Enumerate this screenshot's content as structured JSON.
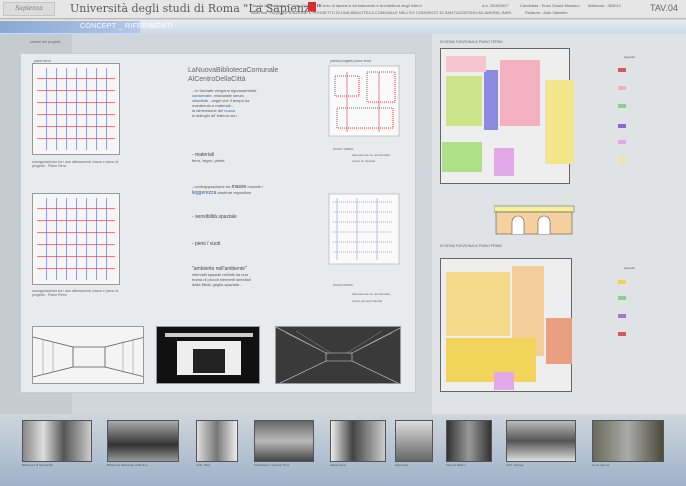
{
  "header": {
    "logo_text": "Sapienza",
    "university": "Università degli studi di Roma \"La Sapienza\"",
    "faculty": "Facoltà di Architettura \"Valle Giulia\"",
    "course": "Corso di laurea in Arredamento e Architettura degli interni",
    "thesis": "Titolo tesi : RIQUALIFICAZIONE E PROGETTO DI UNA BIBLIOTECA COMUNALE NELL'EX CONVENTO DI SANT'AGOSTINO AD ANDRIA, BARI",
    "year": "a.a. 2006/2007",
    "candidate": "Candidata : Enza Grazia Mosaico",
    "matricola": "Matricola : 363012",
    "relatore": "Relatore : Aldo Valentini",
    "tav": "TAV.04"
  },
  "band": {
    "title": "CONCEPT _ RIFERIMENTI"
  },
  "panel": {
    "label": "schemi del progetto",
    "plan1_label": "piano terra",
    "plan1_caption": "sovrapposizione tra i due allineamenti, tracce e piano di progetto - Piano Terra",
    "plan2_caption": "sovrapposizione tra i due allineamenti, tracce e piano di progetto - Piano Primo",
    "title_line1": "LaNuovaBibliotecaComunale",
    "title_line2": "AlCentroDellaCittà",
    "p1a": "...le facciate vengono rigorosamente",
    "p1b": "conservate",
    "p1c": ", restaurate senza",
    "p1d": "chiuderle ; segni che il tempo ha",
    "p1e": "mantenuto e materiali...",
    "p1f": "la dimensione del",
    "p1g": "nuovo",
    "p1h": "si dialoghi all' interno con :",
    "materials_h": "- materiali",
    "materials": "ferro, legno, pietra",
    "contrast_a": "- contrapposizione tra",
    "contrast_b": "masse",
    "contrast_c": "murarie /",
    "contrast_d": "leggerezza",
    "contrast_e": "strutture espositive",
    "sens": "- sensibilità spaziale",
    "pieni": "- pieni / vuoti",
    "amb_a": "\"ambiente nell'ambiente\"",
    "amb_b": "intervalli spaziali nell'atti da una",
    "amb_c": "trama di piccoli elementi lamellari",
    "amb_d": "della filitali, griglia spaziale...",
    "small_plans_label": "pianta progetto piano terra",
    "leg1": "allineamento su una facciata",
    "leg2": "tracce su facciata",
    "leg3": "allineamento su una facciata",
    "leg4": "tracce elementi laterali",
    "pt": "PIANO TERRA",
    "pp": "PIANO PRIMO"
  },
  "right": {
    "title1": "SCHEMA FUNZIONALE PIANO TERRA",
    "title2": "SCHEMA FUNZIONALE PIANO PRIMO",
    "legend_h": "legenda"
  },
  "photos": [
    {
      "caption": "Biblioteca di Stoccarda"
    },
    {
      "caption": "Biblioteca Nazionale di Berlino"
    },
    {
      "caption": "Arch. Mies"
    },
    {
      "caption": "Fondazione \"Herzog\" Pisa"
    },
    {
      "caption": "Allestimento"
    },
    {
      "caption": "Espositori"
    },
    {
      "caption": "Fiera di Milano"
    },
    {
      "caption": "Arch. Scarpa"
    },
    {
      "caption": "Corte interna"
    }
  ],
  "colors": {
    "accent": "#3c5aa0",
    "red": "#d23030",
    "band": "#88a8d4"
  }
}
